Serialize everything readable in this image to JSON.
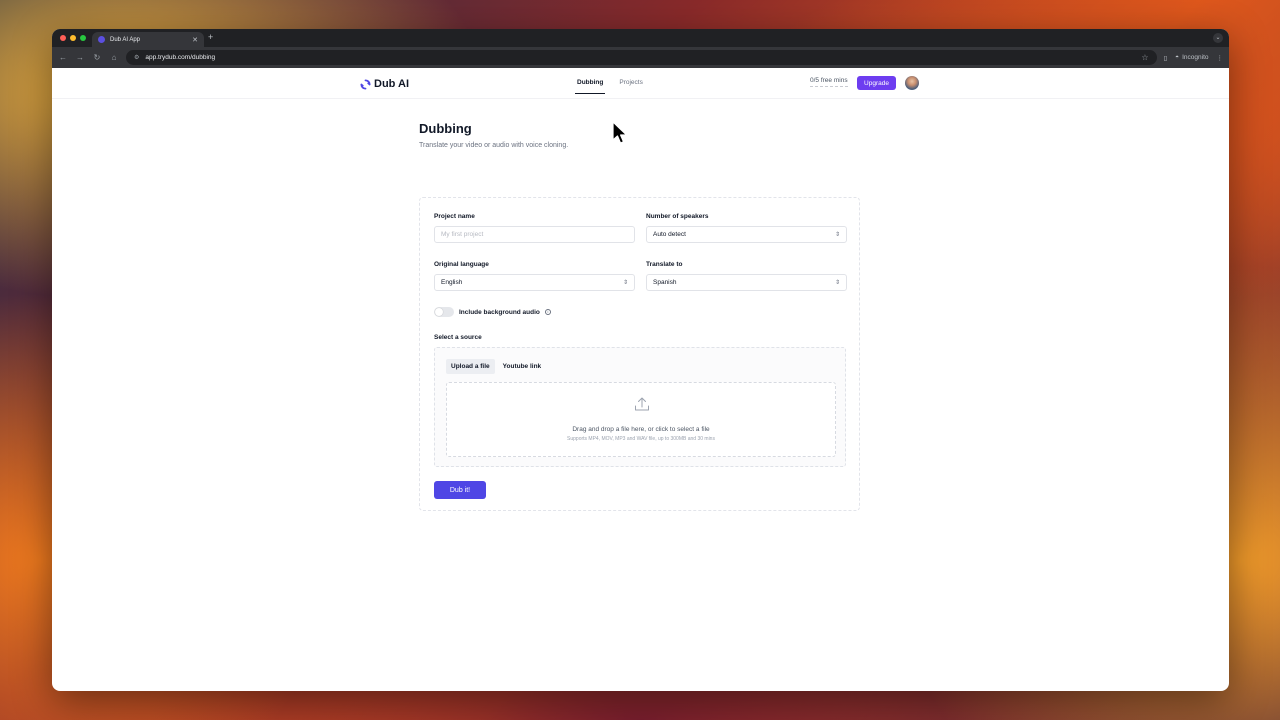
{
  "browser": {
    "tab_title": "Dub AI App",
    "url": "app.trydub.com/dubbing",
    "incognito_label": "Incognito"
  },
  "header": {
    "logo_text": "Dub AI",
    "nav": [
      {
        "label": "Dubbing",
        "active": true
      },
      {
        "label": "Projects",
        "active": false
      }
    ],
    "credits": "0/5 free mins",
    "upgrade_label": "Upgrade"
  },
  "page": {
    "title": "Dubbing",
    "subtitle": "Translate your video or audio with voice cloning."
  },
  "form": {
    "project_name": {
      "label": "Project name",
      "placeholder": "My first project",
      "value": ""
    },
    "speakers": {
      "label": "Number of speakers",
      "value": "Auto detect"
    },
    "original_language": {
      "label": "Original language",
      "value": "English"
    },
    "translate_to": {
      "label": "Translate to",
      "value": "Spanish"
    },
    "background_audio": {
      "label": "Include background audio",
      "enabled": false
    },
    "source": {
      "label": "Select a source",
      "tabs": [
        {
          "label": "Upload a file",
          "active": true
        },
        {
          "label": "Youtube link",
          "active": false
        }
      ],
      "drop_title": "Drag and drop a file here, or click to select a file",
      "drop_hint": "Supports MP4, MOV, MP3 and WAV file, up to 300MB and 30 mins"
    },
    "submit_label": "Dub it!"
  },
  "colors": {
    "accent": "#6d3df0",
    "primary_button": "#4f46e5"
  }
}
